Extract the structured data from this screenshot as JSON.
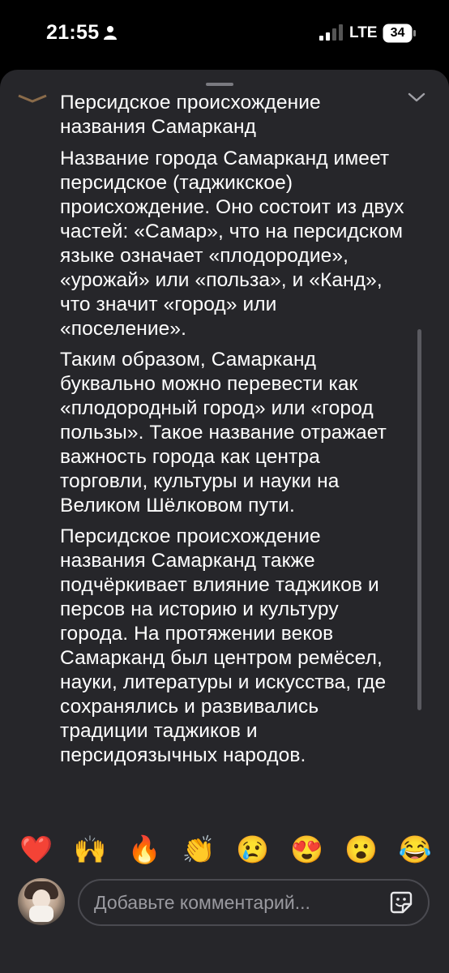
{
  "status_bar": {
    "time": "21:55",
    "network": "LTE",
    "battery": "34",
    "icons": [
      "person-icon",
      "signal-icon",
      "battery-icon"
    ]
  },
  "article": {
    "title": "Персидское происхождение названия Самарканд",
    "paragraphs": [
      "Название города Самарканд имеет персидское (таджикское) происхождение. Оно состоит из двух частей: «Самар», что на персидском языке означает «плодородие», «урожай» или «польза», и «Канд», что значит «город» или «поселение».",
      "Таким образом, Самарканд буквально можно перевести как «плодородный город» или «город пользы». Такое название отражает важность города как центра торговли, культуры и науки на Великом Шёлковом пути.",
      "Персидское происхождение названия Самарканд также подчёркивает влияние таджиков и персов на историю и культуру города. На протяжении веков Самарканд был центром ремёсел, науки, литературы и искусства, где сохранялись и развивались традиции таджиков и персидоязычных народов."
    ]
  },
  "reactions": [
    "❤️",
    "🙌",
    "🔥",
    "👏",
    "😢",
    "😍",
    "😮",
    "😂"
  ],
  "comment": {
    "placeholder": "Добавьте комментарий..."
  },
  "colors": {
    "background": "#000000",
    "sheet": "#26262a",
    "text": "#ffffff",
    "placeholder": "#9a9aa0"
  }
}
